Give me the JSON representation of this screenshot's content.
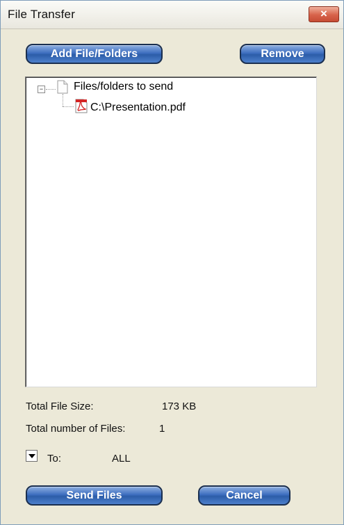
{
  "window": {
    "title": "File Transfer",
    "close_glyph": "×"
  },
  "toolbar": {
    "add_label": "Add File/Folders",
    "remove_label": "Remove"
  },
  "tree": {
    "root_label": "Files/folders to send",
    "root_toggle": "−",
    "children": [
      {
        "label": "C:\\Presentation.pdf",
        "icon": "pdf-icon"
      }
    ]
  },
  "summary": {
    "size_label": "Total File Size:",
    "size_value": "173 KB",
    "count_label": "Total number of Files:",
    "count_value": "1"
  },
  "recipient": {
    "to_label": "To:",
    "to_value": "ALL"
  },
  "actions": {
    "send_label": "Send Files",
    "cancel_label": "Cancel"
  },
  "colors": {
    "button": "#3e6fc0",
    "close_button": "#d7624a",
    "dialog_bg": "#ece9d8"
  }
}
